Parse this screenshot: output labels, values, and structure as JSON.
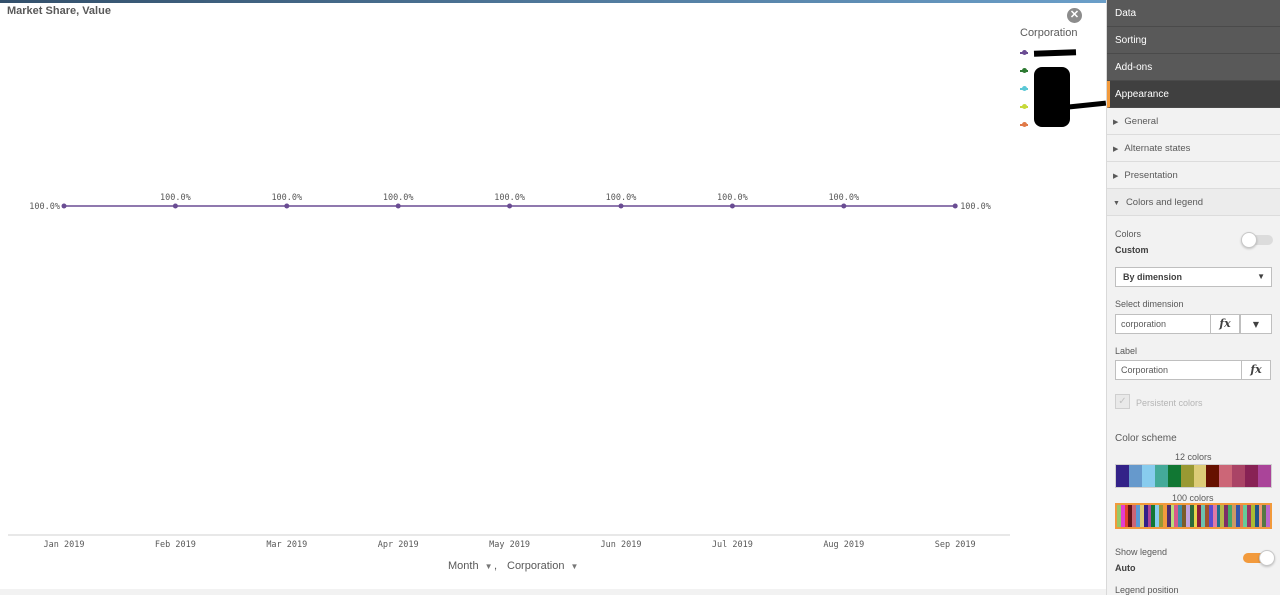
{
  "chart": {
    "title": "Market Share, Value",
    "legend_title": "Corporation",
    "legend_colors": [
      "#6a4c93",
      "#2d7a32",
      "#5bc8d6",
      "#c6d93a",
      "#e07a48"
    ],
    "dimension_1": "Month",
    "dimension_2": "Corporation",
    "separator": ","
  },
  "chart_data": {
    "type": "line",
    "categories": [
      "Jan 2019",
      "Feb 2019",
      "Mar 2019",
      "Apr 2019",
      "May 2019",
      "Jun 2019",
      "Jul 2019",
      "Aug 2019",
      "Sep 2019"
    ],
    "series": [
      {
        "values": [
          100.0,
          100.0,
          100.0,
          100.0,
          100.0,
          100.0,
          100.0,
          100.0,
          100.0
        ],
        "color": "#6a4c93"
      }
    ],
    "data_labels": [
      "100.0%",
      "100.0%",
      "100.0%",
      "100.0%",
      "100.0%",
      "100.0%",
      "100.0%",
      "100.0%",
      "100.0%"
    ],
    "grid": false,
    "legend_position": "right"
  },
  "panel": {
    "tabs": [
      "Data",
      "Sorting",
      "Add-ons",
      "Appearance"
    ],
    "sections": [
      "General",
      "Alternate states",
      "Presentation",
      "Colors and legend"
    ],
    "colors_label": "Colors",
    "colors_value": "Custom",
    "color_mode": "By dimension",
    "select_dimension_label": "Select dimension",
    "select_dimension_value": "corporation",
    "label_label": "Label",
    "label_value": "Corporation",
    "fx": "fx",
    "persistent_colors": "Persistent colors",
    "color_scheme_label": "Color scheme",
    "scheme_12_label": "12 colors",
    "scheme_100_label": "100 colors",
    "scheme_12_colors": [
      "#332288",
      "#6699cc",
      "#88ccee",
      "#44aa99",
      "#117733",
      "#999933",
      "#ddcc77",
      "#661100",
      "#cc6677",
      "#aa4466",
      "#882255",
      "#aa4499"
    ],
    "scheme_100_colors": [
      "#99c867",
      "#e43cd0",
      "#e2402a",
      "#66141a",
      "#cc6677",
      "#5a9ad6",
      "#ddcc77",
      "#332288",
      "#aa4499",
      "#117733",
      "#88ccee",
      "#999933",
      "#f29a3c",
      "#4b2b6e",
      "#b8e07a",
      "#d65a8c",
      "#3e8fa8",
      "#7b5c2a",
      "#c2a3e0",
      "#2d6b3a",
      "#e8d44d",
      "#8c1c3c",
      "#6cc2b0",
      "#a0522d",
      "#5b4bd1",
      "#e07aa5",
      "#1f6e8c",
      "#b7b74a",
      "#7d2e68",
      "#44aa66",
      "#cc9966",
      "#3355aa",
      "#dd7755",
      "#66cc99",
      "#993366",
      "#aabb33",
      "#225588",
      "#ee9977",
      "#557744",
      "#bb66cc"
    ],
    "show_legend_label": "Show legend",
    "show_legend_value": "Auto",
    "legend_position_label": "Legend position",
    "accent": "#f29a3c"
  }
}
